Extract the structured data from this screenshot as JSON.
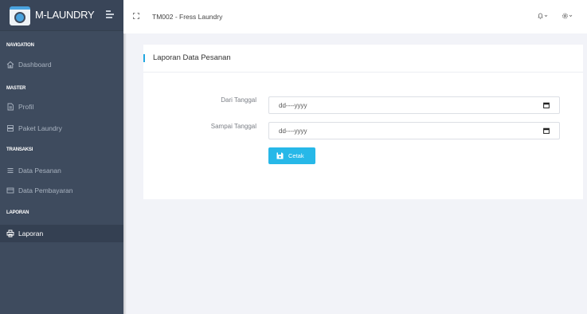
{
  "brand": {
    "name": "M-LAUNDRY"
  },
  "sidebar": {
    "sections": [
      {
        "heading": "NAVIGATION",
        "items": [
          {
            "label": "Dashboard",
            "icon": "home-icon"
          }
        ]
      },
      {
        "heading": "MASTER",
        "items": [
          {
            "label": "Profil",
            "icon": "document-icon"
          },
          {
            "label": "Paket Laundry",
            "icon": "server-icon"
          }
        ]
      },
      {
        "heading": "TRANSAKSI",
        "items": [
          {
            "label": "Data Pesanan",
            "icon": "list-icon"
          },
          {
            "label": "Data Pembayaran",
            "icon": "credit-card-icon"
          }
        ]
      },
      {
        "heading": "LAPORAN",
        "items": [
          {
            "label": "Laporan",
            "icon": "printer-icon",
            "active": true
          }
        ]
      }
    ]
  },
  "topbar": {
    "page_heading": "TM002 - Fress Laundry"
  },
  "card": {
    "title": "Laporan Data Pesanan",
    "from_label": "Dari Tanggal",
    "from_placeholder": "dd----yyyy",
    "to_label": "Sampai Tanggal",
    "to_placeholder": "dd----yyyy",
    "print_label": "Cetak"
  },
  "colors": {
    "sidebar_bg": "#3e4b5e",
    "accent": "#21a7e0",
    "button": "#27b8e8"
  }
}
